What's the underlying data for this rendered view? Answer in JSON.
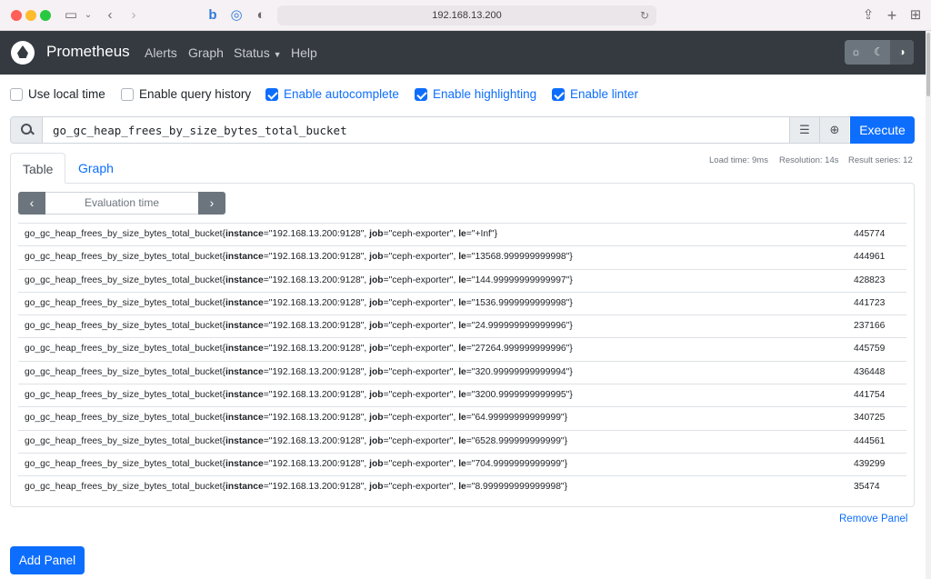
{
  "browser": {
    "url": "192.168.13.200"
  },
  "navbar": {
    "brand": "Prometheus",
    "links": [
      "Alerts",
      "Graph",
      "Status",
      "Help"
    ]
  },
  "options": [
    {
      "label": "Use local time",
      "checked": false
    },
    {
      "label": "Enable query history",
      "checked": false
    },
    {
      "label": "Enable autocomplete",
      "checked": true
    },
    {
      "label": "Enable highlighting",
      "checked": true
    },
    {
      "label": "Enable linter",
      "checked": true
    }
  ],
  "query": {
    "expression": "go_gc_heap_frees_by_size_bytes_total_bucket",
    "execute_label": "Execute"
  },
  "tabs": {
    "table": "Table",
    "graph": "Graph"
  },
  "stats": {
    "load_time": "Load time: 9ms",
    "resolution": "Resolution: 14s",
    "result_series": "Result series: 12"
  },
  "eval": {
    "placeholder": "Evaluation time",
    "prev": "‹",
    "next": "›"
  },
  "results": [
    {
      "metric": "go_gc_heap_frees_by_size_bytes_total_bucket{",
      "k1": "instance",
      "v1": "=\"192.168.13.200:9128\", ",
      "k2": "job",
      "v2": "=\"ceph-exporter\", ",
      "k3": "le",
      "v3": "=\"+Inf\"}",
      "value": "445774"
    },
    {
      "metric": "go_gc_heap_frees_by_size_bytes_total_bucket{",
      "k1": "instance",
      "v1": "=\"192.168.13.200:9128\", ",
      "k2": "job",
      "v2": "=\"ceph-exporter\", ",
      "k3": "le",
      "v3": "=\"13568.999999999998\"}",
      "value": "444961"
    },
    {
      "metric": "go_gc_heap_frees_by_size_bytes_total_bucket{",
      "k1": "instance",
      "v1": "=\"192.168.13.200:9128\", ",
      "k2": "job",
      "v2": "=\"ceph-exporter\", ",
      "k3": "le",
      "v3": "=\"144.99999999999997\"}",
      "value": "428823"
    },
    {
      "metric": "go_gc_heap_frees_by_size_bytes_total_bucket{",
      "k1": "instance",
      "v1": "=\"192.168.13.200:9128\", ",
      "k2": "job",
      "v2": "=\"ceph-exporter\", ",
      "k3": "le",
      "v3": "=\"1536.9999999999998\"}",
      "value": "441723"
    },
    {
      "metric": "go_gc_heap_frees_by_size_bytes_total_bucket{",
      "k1": "instance",
      "v1": "=\"192.168.13.200:9128\", ",
      "k2": "job",
      "v2": "=\"ceph-exporter\", ",
      "k3": "le",
      "v3": "=\"24.999999999999996\"}",
      "value": "237166"
    },
    {
      "metric": "go_gc_heap_frees_by_size_bytes_total_bucket{",
      "k1": "instance",
      "v1": "=\"192.168.13.200:9128\", ",
      "k2": "job",
      "v2": "=\"ceph-exporter\", ",
      "k3": "le",
      "v3": "=\"27264.999999999996\"}",
      "value": "445759"
    },
    {
      "metric": "go_gc_heap_frees_by_size_bytes_total_bucket{",
      "k1": "instance",
      "v1": "=\"192.168.13.200:9128\", ",
      "k2": "job",
      "v2": "=\"ceph-exporter\", ",
      "k3": "le",
      "v3": "=\"320.99999999999994\"}",
      "value": "436448"
    },
    {
      "metric": "go_gc_heap_frees_by_size_bytes_total_bucket{",
      "k1": "instance",
      "v1": "=\"192.168.13.200:9128\", ",
      "k2": "job",
      "v2": "=\"ceph-exporter\", ",
      "k3": "le",
      "v3": "=\"3200.9999999999995\"}",
      "value": "441754"
    },
    {
      "metric": "go_gc_heap_frees_by_size_bytes_total_bucket{",
      "k1": "instance",
      "v1": "=\"192.168.13.200:9128\", ",
      "k2": "job",
      "v2": "=\"ceph-exporter\", ",
      "k3": "le",
      "v3": "=\"64.99999999999999\"}",
      "value": "340725"
    },
    {
      "metric": "go_gc_heap_frees_by_size_bytes_total_bucket{",
      "k1": "instance",
      "v1": "=\"192.168.13.200:9128\", ",
      "k2": "job",
      "v2": "=\"ceph-exporter\", ",
      "k3": "le",
      "v3": "=\"6528.999999999999\"}",
      "value": "444561"
    },
    {
      "metric": "go_gc_heap_frees_by_size_bytes_total_bucket{",
      "k1": "instance",
      "v1": "=\"192.168.13.200:9128\", ",
      "k2": "job",
      "v2": "=\"ceph-exporter\", ",
      "k3": "le",
      "v3": "=\"704.9999999999999\"}",
      "value": "439299"
    },
    {
      "metric": "go_gc_heap_frees_by_size_bytes_total_bucket{",
      "k1": "instance",
      "v1": "=\"192.168.13.200:9128\", ",
      "k2": "job",
      "v2": "=\"ceph-exporter\", ",
      "k3": "le",
      "v3": "=\"8.999999999999998\"}",
      "value": "35474"
    }
  ],
  "actions": {
    "remove_panel": "Remove Panel",
    "add_panel": "Add Panel"
  },
  "colors": {
    "accent": "#0d6efd",
    "navbar": "#343a40"
  }
}
